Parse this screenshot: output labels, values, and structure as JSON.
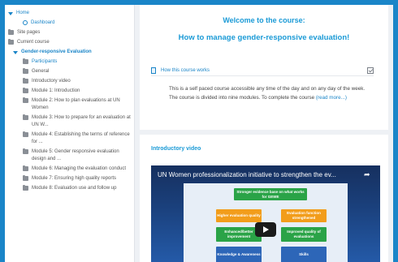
{
  "sidebar": {
    "items": [
      {
        "label": "Home",
        "icon": "caret-down-icon",
        "link": true
      },
      {
        "label": "Dashboard",
        "icon": "circle-icon",
        "link": true
      },
      {
        "label": "Site pages",
        "icon": "folder-icon"
      },
      {
        "label": "Current course",
        "icon": "folder-icon"
      },
      {
        "label": "Gender-responsive Evaluation",
        "icon": "caret-down-icon",
        "link": true,
        "bold": true
      },
      {
        "label": "Participants",
        "icon": "folder-icon",
        "link": true
      },
      {
        "label": "General",
        "icon": "folder-icon"
      },
      {
        "label": "Introductory video",
        "icon": "folder-icon"
      },
      {
        "label": "Module 1: Introduction",
        "icon": "folder-icon"
      },
      {
        "label": "Module 2: How to plan evaluations at UN Women",
        "icon": "folder-icon"
      },
      {
        "label": "Module 3: How to prepare for an evaluation at UN W...",
        "icon": "folder-icon"
      },
      {
        "label": "Module 4: Establishing the terms of reference for ...",
        "icon": "folder-icon"
      },
      {
        "label": "Module 5: Gender responsive evaluation design and ...",
        "icon": "folder-icon"
      },
      {
        "label": "Module 6: Managing the evaluation conduct",
        "icon": "folder-icon"
      },
      {
        "label": "Module 7: Ensuring high quality reports",
        "icon": "folder-icon"
      },
      {
        "label": "Module 8: Evaluation use and follow up",
        "icon": "folder-icon"
      }
    ]
  },
  "main": {
    "welcome_line1": "Welcome to the course:",
    "welcome_line2": "How to manage gender-responsive evaluation!",
    "how_link": "How this course works",
    "description": "This is a self paced course accessible any time of the day and on any day of the week. The course is divided into nine modules. To complete the course",
    "read_more": "(read more...)",
    "video_section_title": "Introductory video",
    "video_title": "UN Women professionalization initiative to strengthen the ev...",
    "diagram": {
      "top_box": "Stronger evidence base on what works for GEWE",
      "left_orange": "Higher evaluation quality",
      "right_orange": "Evaluation function strengthened",
      "left_green": "Enhanced/better improvement",
      "right_green": "Improved quality of evaluations",
      "bottom_left": "Knowledge & Awareness",
      "bottom_right": "Skills"
    }
  },
  "colors": {
    "accent": "#1a9ad6",
    "frame": "#1a85c8"
  }
}
